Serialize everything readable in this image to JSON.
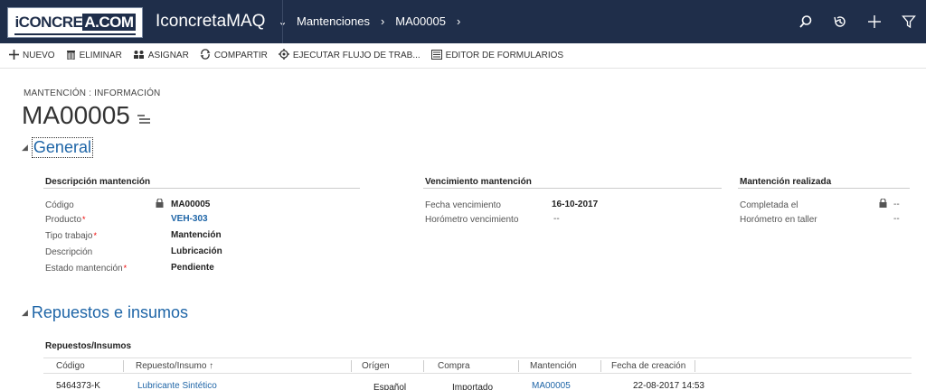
{
  "logo": {
    "part1": "iCONCRE",
    "part2": "A.COM"
  },
  "app": {
    "title": "IconcretaMAQ",
    "chevron": "⌄"
  },
  "breadcrumb": {
    "entity": "Mantenciones",
    "record": "MA00005"
  },
  "top_icons": [
    "search-icon",
    "history-icon",
    "plus-icon",
    "filter-icon"
  ],
  "command_bar": [
    {
      "label": "NUEVO",
      "icon": "plus-icon"
    },
    {
      "label": "ELIMINAR",
      "icon": "trash-icon"
    },
    {
      "label": "ASIGNAR",
      "icon": "assign-icon"
    },
    {
      "label": "COMPARTIR",
      "icon": "share-icon"
    },
    {
      "label": "EJECUTAR FLUJO DE TRAB...",
      "icon": "workflow-icon"
    },
    {
      "label": "EDITOR DE FORMULARIOS",
      "icon": "form-editor-icon"
    }
  ],
  "form": {
    "entity_label": "MANTENCIÓN : INFORMACIÓN",
    "title": "MA00005",
    "general_section": "General",
    "desc_section": {
      "heading": "Descripción mantención",
      "fields": [
        {
          "label": "Código",
          "value": "MA00005",
          "required": false,
          "locked": true
        },
        {
          "label": "Producto",
          "value": "VEH-303",
          "required": true,
          "link": true
        },
        {
          "label": "Tipo trabajo",
          "value": "Mantención",
          "required": true
        },
        {
          "label": "Descripción",
          "value": "Lubricación",
          "required": false
        },
        {
          "label": "Estado mantención",
          "value": "Pendiente",
          "required": true
        }
      ]
    },
    "venc_section": {
      "heading": "Vencimiento mantención",
      "fields": [
        {
          "label": "Fecha vencimiento",
          "value": "16-10-2017"
        },
        {
          "label": "Horómetro vencimiento",
          "value": "--"
        }
      ]
    },
    "realizada_section": {
      "heading": "Mantención realizada",
      "fields": [
        {
          "label": "Completada el",
          "value": "--",
          "locked": true
        },
        {
          "label": "Horómetro en taller",
          "value": "--"
        }
      ]
    },
    "repuestos_section": "Repuestos e insumos"
  },
  "subgrid": {
    "title": "Repuestos/Insumos",
    "columns": [
      "Código",
      "Repuesto/Insumo ↑",
      "Orígen",
      "Compra",
      "Mantención",
      "Fecha de creación"
    ],
    "rows": [
      {
        "codigo": "5464373-K",
        "repuesto": "Lubricante Sintético",
        "origen": "Español",
        "compra": "Importado",
        "mantencion": "MA00005",
        "fecha": "22-08-2017 14:53"
      }
    ]
  }
}
